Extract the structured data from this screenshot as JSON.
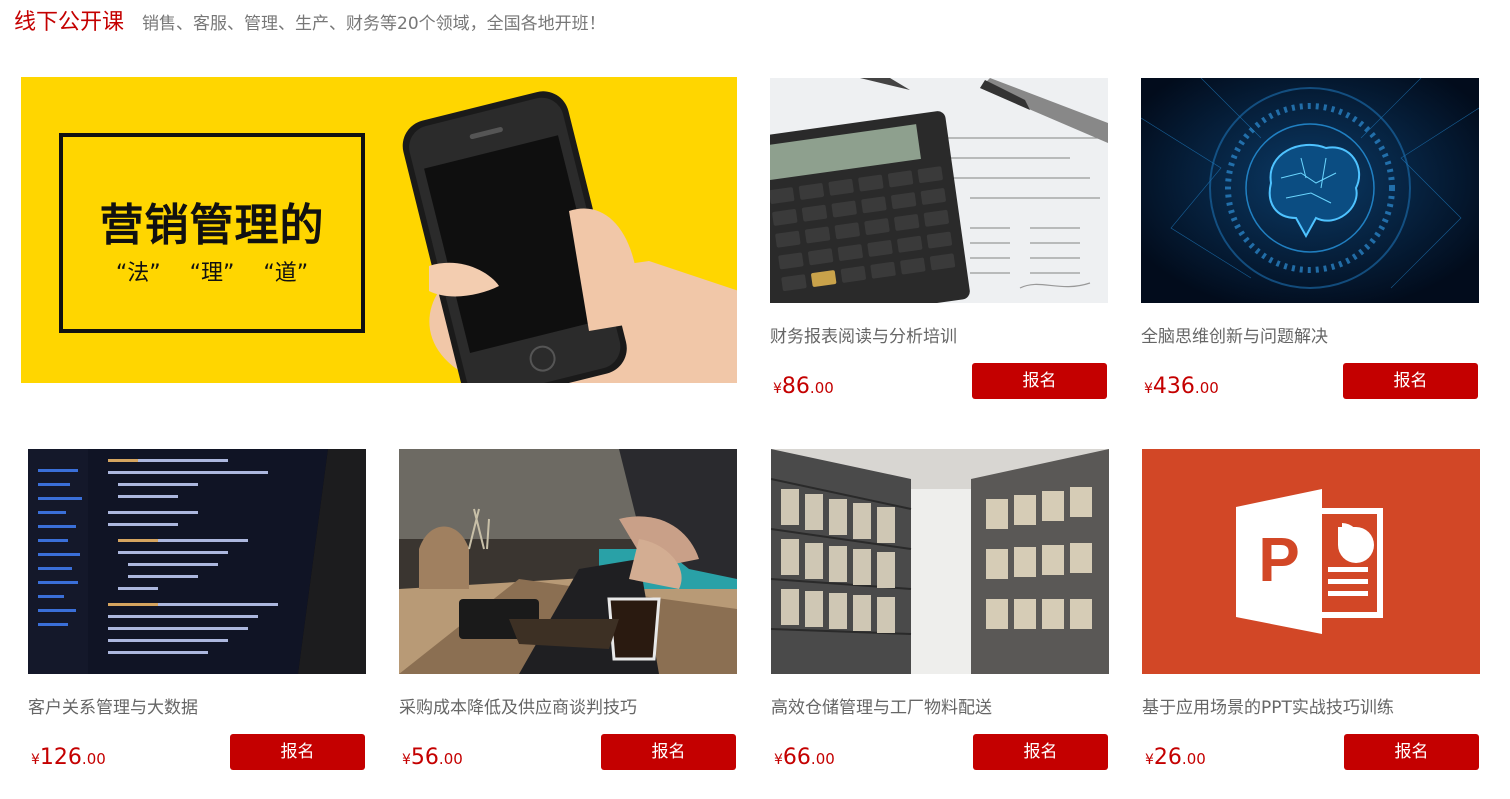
{
  "header": {
    "title": "线下公开课",
    "subtitle": "销售、客服、管理、生产、财务等20个领域，全国各地开班！"
  },
  "banner": {
    "title": "营销管理的",
    "subtitle": "“法” “理” “道”",
    "image_icon": "phone-in-hand-image"
  },
  "courses": [
    {
      "title": "财务报表阅读与分析培训",
      "currency": "¥",
      "price_int": "86",
      "price_dec": ".00",
      "button": "报名",
      "image": "calculator-image"
    },
    {
      "title": "全脑思维创新与问题解决",
      "currency": "¥",
      "price_int": "436",
      "price_dec": ".00",
      "button": "报名",
      "image": "brain-image"
    },
    {
      "title": "客户关系管理与大数据",
      "currency": "¥",
      "price_int": "126",
      "price_dec": ".00",
      "button": "报名",
      "image": "code-screen-image"
    },
    {
      "title": "采购成本降低及供应商谈判技巧",
      "currency": "¥",
      "price_int": "56",
      "price_dec": ".00",
      "button": "报名",
      "image": "handshake-image"
    },
    {
      "title": "高效仓储管理与工厂物料配送",
      "currency": "¥",
      "price_int": "66",
      "price_dec": ".00",
      "button": "报名",
      "image": "warehouse-image"
    },
    {
      "title": "基于应用场景的PPT实战技巧训练",
      "currency": "¥",
      "price_int": "26",
      "price_dec": ".00",
      "button": "报名",
      "image": "powerpoint-image"
    }
  ],
  "colors": {
    "accent": "#c40000",
    "banner_bg": "#ffd600",
    "ppt_orange": "#d24726"
  }
}
